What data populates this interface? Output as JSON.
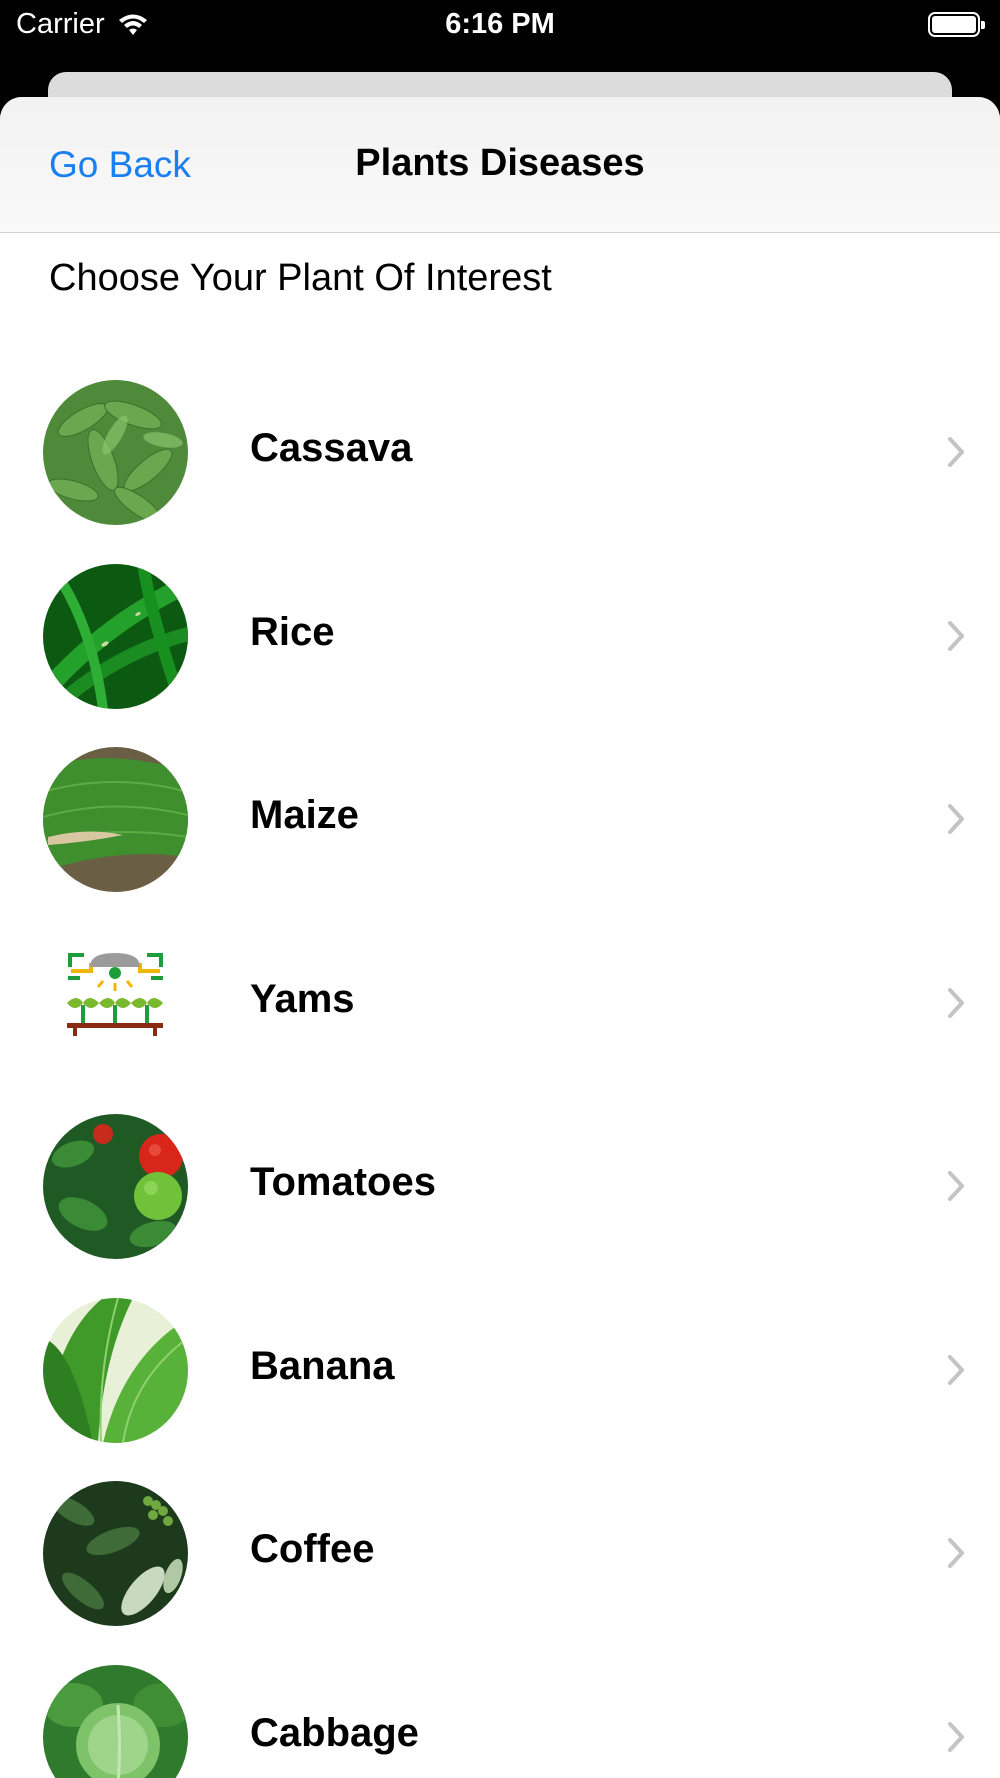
{
  "status_bar": {
    "carrier": "Carrier",
    "time": "6:16 PM"
  },
  "nav": {
    "back_label": "Go Back",
    "title": "Plants Diseases"
  },
  "subtitle": "Choose Your Plant Of Interest",
  "plants": [
    {
      "label": "Cassava",
      "icon": "cassava-leaf-thumbnail"
    },
    {
      "label": "Rice",
      "icon": "rice-leaf-thumbnail"
    },
    {
      "label": "Maize",
      "icon": "maize-leaf-thumbnail"
    },
    {
      "label": "Yams",
      "icon": "smart-farm-icon"
    },
    {
      "label": "Tomatoes",
      "icon": "tomato-plant-thumbnail"
    },
    {
      "label": "Banana",
      "icon": "banana-leaf-thumbnail"
    },
    {
      "label": "Coffee",
      "icon": "coffee-plant-thumbnail"
    },
    {
      "label": "Cabbage",
      "icon": "cabbage-thumbnail"
    }
  ],
  "colors": {
    "link": "#1a7ff0",
    "chevron": "#c4c4c4"
  }
}
